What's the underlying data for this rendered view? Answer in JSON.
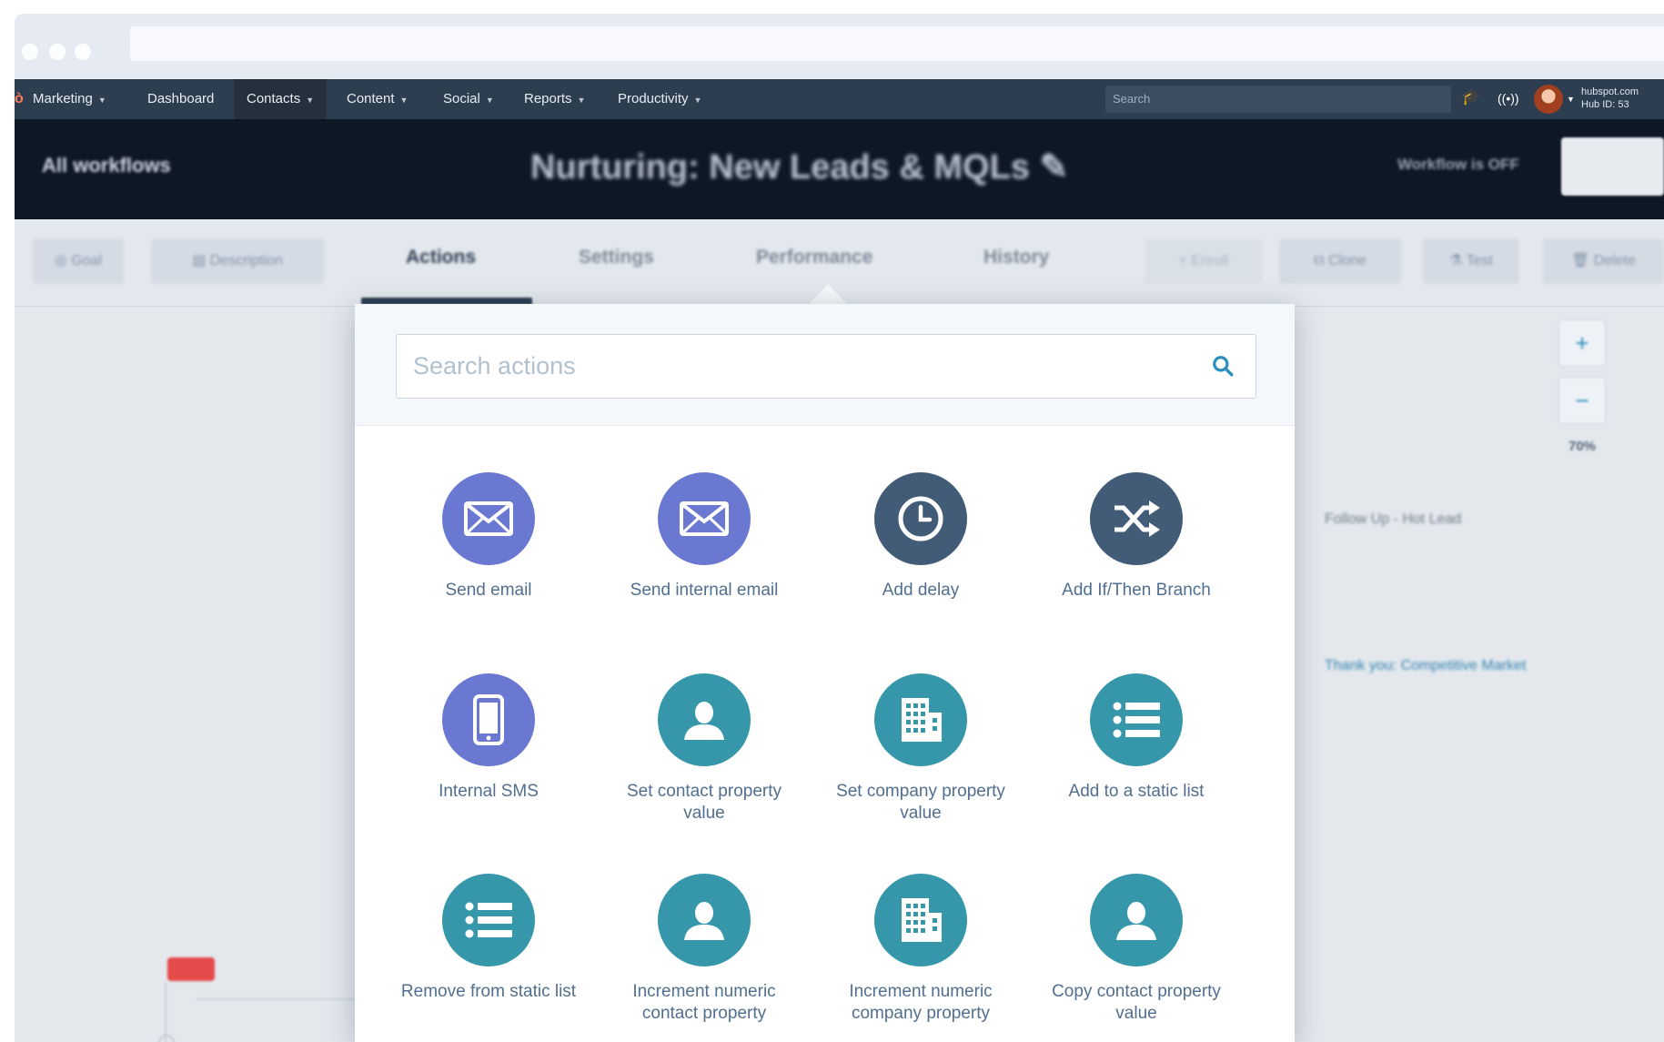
{
  "nav": {
    "items": [
      {
        "label": "Marketing",
        "caret": true,
        "active": false
      },
      {
        "label": "Dashboard",
        "caret": false,
        "active": false
      },
      {
        "label": "Contacts",
        "caret": true,
        "active": true
      },
      {
        "label": "Content",
        "caret": true,
        "active": false
      },
      {
        "label": "Social",
        "caret": true,
        "active": false
      },
      {
        "label": "Reports",
        "caret": true,
        "active": false
      },
      {
        "label": "Productivity",
        "caret": true,
        "active": false
      }
    ],
    "search_placeholder": "Search",
    "account_line1": "hubspot.com",
    "account_line2": "Hub ID: 53"
  },
  "header": {
    "back_link": "All workflows",
    "title": "Nurturing: New Leads & MQLs",
    "status": "Workflow is OFF"
  },
  "toolbar": {
    "goal": "Goal",
    "description": "Description",
    "tabs": [
      "Actions",
      "Settings",
      "Performance",
      "History"
    ],
    "active_tab": "Actions",
    "enroll": "Enroll",
    "clone": "Clone",
    "test": "Test",
    "delete": "Delete"
  },
  "canvas": {
    "zoom_level": "70%",
    "bg_text_1": "Follow Up - Hot Lead",
    "bg_text_2": "Thank you: Competitive Market"
  },
  "panel": {
    "search_placeholder": "Search actions",
    "actions": [
      {
        "label": "Send email",
        "icon": "envelope-icon",
        "color": "#6a78d1"
      },
      {
        "label": "Send internal email",
        "icon": "envelope-icon",
        "color": "#6a78d1"
      },
      {
        "label": "Add delay",
        "icon": "clock-icon",
        "color": "#425b76"
      },
      {
        "label": "Add If/Then Branch",
        "icon": "shuffle-icon",
        "color": "#425b76"
      },
      {
        "label": "Internal SMS",
        "icon": "phone-icon",
        "color": "#6a78d1"
      },
      {
        "label": "Set contact property value",
        "icon": "person-icon",
        "color": "#3697ab"
      },
      {
        "label": "Set company property value",
        "icon": "building-icon",
        "color": "#3697ab"
      },
      {
        "label": "Add to a static list",
        "icon": "list-icon",
        "color": "#3697ab"
      },
      {
        "label": "Remove from static list",
        "icon": "list-icon",
        "color": "#3697ab"
      },
      {
        "label": "Increment numeric contact property",
        "icon": "person-icon",
        "color": "#3697ab"
      },
      {
        "label": "Increment numeric company property",
        "icon": "building-icon",
        "color": "#3697ab"
      },
      {
        "label": "Copy contact property value",
        "icon": "person-icon",
        "color": "#3697ab"
      }
    ]
  }
}
